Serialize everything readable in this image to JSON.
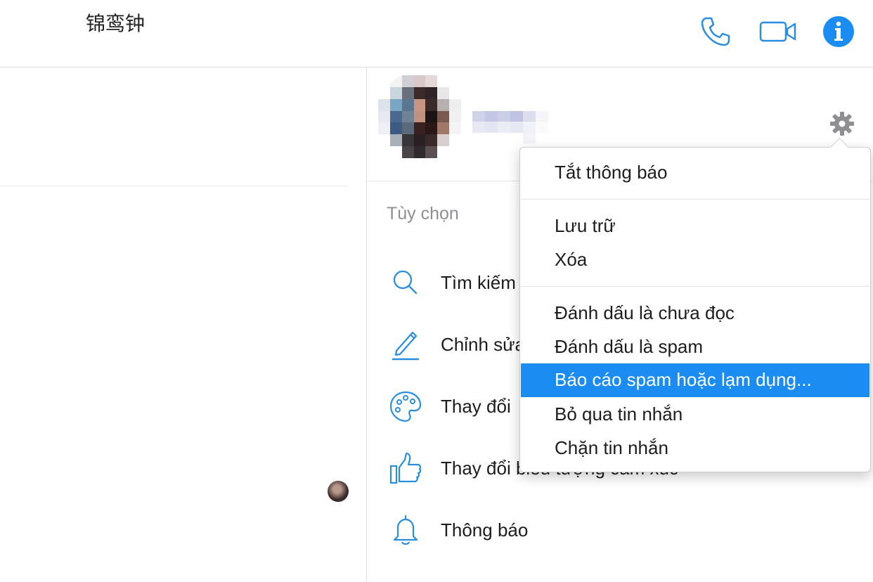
{
  "header": {
    "title": "锦鸾钟",
    "call_icon": "phone-icon",
    "video_icon": "video-camera-icon",
    "info_icon": "info-icon"
  },
  "colors": {
    "accent": "#1a8cf2",
    "icon_blue": "#2a8ee0",
    "gear_gray": "#8e8e93",
    "label_gray": "#8e8e93"
  },
  "profile": {
    "settings_icon": "gear-icon"
  },
  "options": {
    "section_label": "Tùy chọn",
    "items": [
      {
        "icon": "search-icon",
        "label": "Tìm kiếm"
      },
      {
        "icon": "pencil-icon",
        "label": "Chỉnh sửa"
      },
      {
        "icon": "palette-icon",
        "label": "Thay đổi"
      },
      {
        "icon": "thumbs-up-icon",
        "label": "Thay đổi biểu tượng cảm xúc"
      },
      {
        "icon": "bell-icon",
        "label": "Thông báo"
      }
    ]
  },
  "menu": {
    "groups": [
      [
        "Tắt thông báo"
      ],
      [
        "Lưu trữ",
        "Xóa"
      ],
      [
        "Đánh dấu là chưa đọc",
        "Đánh dấu là spam",
        "Báo cáo spam hoặc lạm dụng...",
        "Bỏ qua tin nhắn",
        "Chặn tin nhắn"
      ]
    ],
    "highlighted": "Báo cáo spam hoặc lạm dụng..."
  }
}
